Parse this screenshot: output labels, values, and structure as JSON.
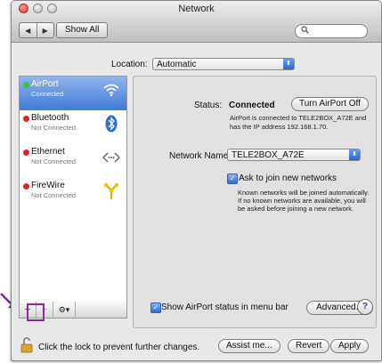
{
  "window": {
    "title": "Network"
  },
  "toolbar": {
    "back_glyph": "◀",
    "forward_glyph": "▶",
    "show_all": "Show All",
    "search_glyph": "🔍"
  },
  "location": {
    "label": "Location:",
    "value": "Automatic"
  },
  "services": [
    {
      "name": "AirPort",
      "status": "Connected",
      "dot_color": "#3cc43c",
      "icon": "wifi-icon"
    },
    {
      "name": "Bluetooth",
      "status": "Not Connected",
      "dot_color": "#d7262b",
      "icon": "bluetooth-icon"
    },
    {
      "name": "Ethernet",
      "status": "Not Connected",
      "dot_color": "#d7262b",
      "icon": "ethernet-icon"
    },
    {
      "name": "FireWire",
      "status": "Not Connected",
      "dot_color": "#d7262b",
      "icon": "firewire-icon"
    }
  ],
  "list_buttons": {
    "add": "+",
    "remove": "−",
    "action": "⚙▾"
  },
  "detail": {
    "status_label": "Status:",
    "status_value": "Connected",
    "turn_off": "Turn AirPort Off",
    "status_desc_1": "AirPort is connected to TELE2BOX_A72E and",
    "status_desc_2": "has the IP address 192.168.1.70.",
    "network_name_label": "Network Name:",
    "network_name_value": "TELE2BOX_A72E",
    "ask_join": "Ask to join new networks",
    "ask_desc_1": "Known networks will be joined automatically.",
    "ask_desc_2": "If no known networks are available, you will",
    "ask_desc_3": "be asked before joining a new network.",
    "show_status": "Show AirPort status in menu bar",
    "advanced": "Advanced...",
    "help": "?"
  },
  "footer": {
    "lock_text": "Click the lock to prevent further changes.",
    "assist": "Assist me...",
    "revert": "Revert",
    "apply": "Apply"
  },
  "colors": {
    "selection": "#3f7ad6",
    "annotation": "#8a2aa0"
  }
}
